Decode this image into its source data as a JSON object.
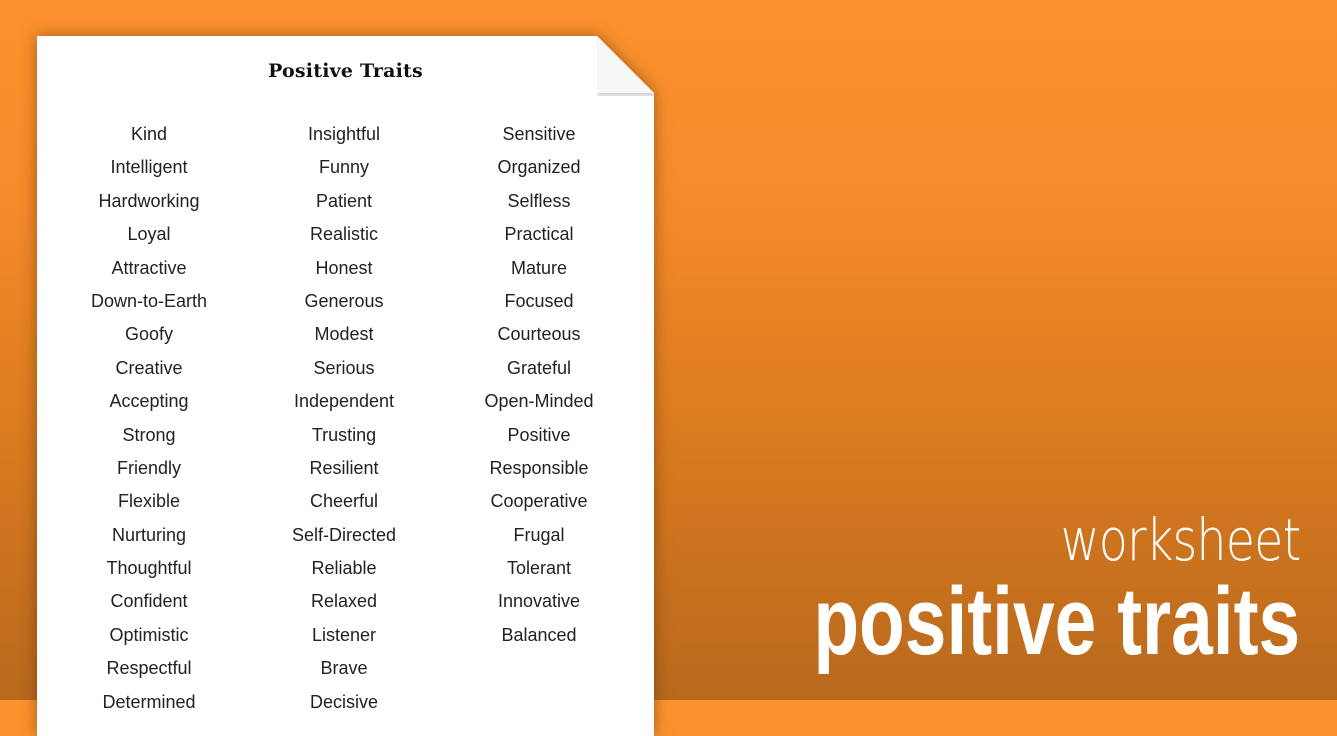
{
  "worksheet": {
    "title": "Positive Traits",
    "columns": [
      [
        "Kind",
        "Intelligent",
        "Hardworking",
        "Loyal",
        "Attractive",
        "Down-to-Earth",
        "Goofy",
        "Creative",
        "Accepting",
        "Strong",
        "Friendly",
        "Flexible",
        "Nurturing",
        "Thoughtful",
        "Confident",
        "Optimistic",
        "Respectful",
        "Determined"
      ],
      [
        "Insightful",
        "Funny",
        "Patient",
        "Realistic",
        "Honest",
        "Generous",
        "Modest",
        "Serious",
        "Independent",
        "Trusting",
        "Resilient",
        "Cheerful",
        "Self-Directed",
        "Reliable",
        "Relaxed",
        "Listener",
        "Brave",
        "Decisive"
      ],
      [
        "Sensitive",
        "Organized",
        "Selfless",
        "Practical",
        "Mature",
        "Focused",
        "Courteous",
        "Grateful",
        "Open-Minded",
        "Positive",
        "Responsible",
        "Cooperative",
        "Frugal",
        "Tolerant",
        "Innovative",
        "Balanced"
      ]
    ]
  },
  "hero": {
    "subtitle": "worksheet",
    "title": "positive traits"
  },
  "colors": {
    "background_top": "#fd932e",
    "background_bottom": "#b8691e",
    "page": "#ffffff",
    "text": "#222222"
  }
}
